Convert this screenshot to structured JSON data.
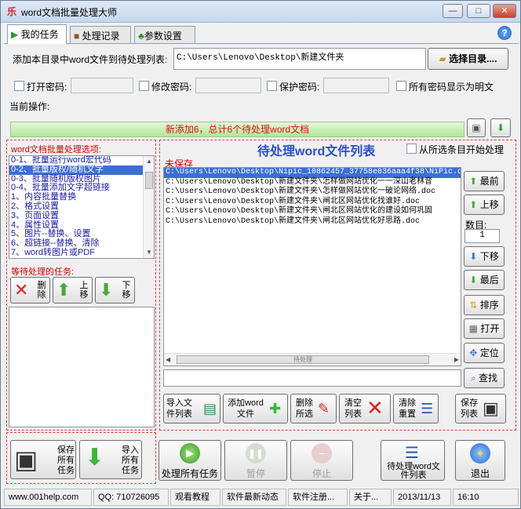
{
  "window": {
    "title": "word文档批量处理大师",
    "min": "—",
    "max": "□",
    "close": "✕"
  },
  "tabs": [
    {
      "label": "我的任务"
    },
    {
      "label": "处理记录"
    },
    {
      "label": "参数设置"
    }
  ],
  "help": "?",
  "add": {
    "label": "添加本目录中word文件到待处理列表:",
    "path": "C:\\Users\\Lenovo\\Desktop\\新建文件夹",
    "choose": "选择目录...."
  },
  "passwords": {
    "open": "打开密码:",
    "modify": "修改密码:",
    "protect": "保护密码:",
    "show": "所有密码显示为明文"
  },
  "current_op": "当前操作:",
  "progress": {
    "text": "新添加6，总计6个待处理word文档",
    "fraction": 1.0
  },
  "options": {
    "title": "word文档批量处理选项:",
    "items": [
      "0-1、批量运行word宏代码",
      "0-2、批量版权/随机文字",
      "0-3、批量随机版权图片",
      "0-4、批量添加文字超链接",
      "1、内容批量替换",
      "2、格式设置",
      "3、页面设置",
      "4、属性设置",
      "5、图片--替换、设置",
      "6、超链接--替换、清除",
      "7、word转图片或PDF"
    ],
    "selected": 1
  },
  "waiting": {
    "title": "等待处理的任务:",
    "delete": "删除",
    "up": "上移",
    "down": "下移"
  },
  "filelist": {
    "title": "待处理word文件列表",
    "from_selected": "从所选条目开始处理",
    "unsaved": "未保存",
    "files": [
      "C:\\Users\\Lenovo\\Desktop\\Nipic_10862457_37758e036aaa4f38\\NiPic.d",
      "C:\\Users\\Lenovo\\Desktop\\新建文件夹\\怎样做网站优化一一深山老林音",
      "C:\\Users\\Lenovo\\Desktop\\新建文件夹\\怎样做网站优化一破论网络.doc",
      "C:\\Users\\Lenovo\\Desktop\\新建文件夹\\闸北区网站优化找谁好.doc",
      "C:\\Users\\Lenovo\\Desktop\\新建文件夹\\闸北区网站优化的建设如何巩固",
      "C:\\Users\\Lenovo\\Desktop\\新建文件夹\\闸北区网站优化好思路.doc"
    ],
    "selected": 0,
    "grip": "待处理"
  },
  "side": {
    "top": "最前",
    "up": "上移",
    "count_label": "数目:",
    "count": "1",
    "down": "下移",
    "bottom": "最后",
    "sort": "排序",
    "open": "打开",
    "locate": "定位",
    "find": "查找"
  },
  "bottom_btns": {
    "import": "导入文件列表",
    "add": "添加word文件",
    "delete": "删除所选",
    "clear": "清空列表",
    "reset": "清除重置",
    "save": "保存列表"
  },
  "footer": {
    "save_tasks": "保存所有任务",
    "import_tasks": "导入所有任务",
    "process_all": "处理所有任务",
    "pause": "暂停",
    "stop": "停止",
    "pending": "待处理word文件列表",
    "exit": "退出"
  },
  "status": {
    "site": "www.001help.com",
    "qq": "QQ: 710726095",
    "tutorial": "观看教程",
    "news": "软件最新动态",
    "register": "软件注册...",
    "about": "关于...",
    "date": "2013/11/13",
    "time": "16:10"
  },
  "colors": {
    "accent": "#3c6fd4",
    "red": "#e04040",
    "progress": "#b2e69a"
  }
}
